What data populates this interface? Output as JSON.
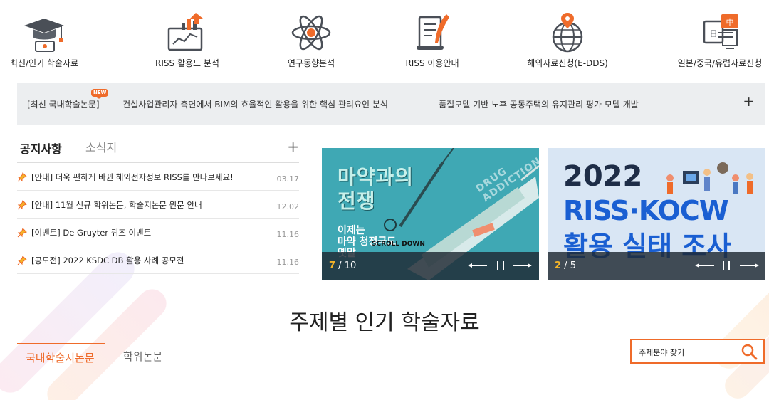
{
  "quick_menu": [
    {
      "label": "최신/인기 학술자료",
      "icon": "graduation-cap-icon"
    },
    {
      "label": "RISS 활용도 분석",
      "icon": "bar-chart-icon"
    },
    {
      "label": "연구동향분석",
      "icon": "atom-icon"
    },
    {
      "label": "RISS 이용안내",
      "icon": "scroll-quill-icon"
    },
    {
      "label": "해외자료신청(E-DDS)",
      "icon": "globe-pin-icon"
    },
    {
      "label": "일본/중국/유럽자료신청",
      "icon": "language-board-icon",
      "badge_cn": "中",
      "badge_jp": "日"
    }
  ],
  "recent_papers": {
    "category": "[최신 국내학술논문]",
    "new_badge": "NEW",
    "items": [
      "- 건설사업관리자 측면에서 BIM의 효율적인 활용을 위한 핵심 관리요인 분석",
      "- 품질모델 기반 노후 공동주택의 유지관리 평가 모델 개발"
    ],
    "more": "+"
  },
  "notice": {
    "tabs": [
      "공지사항",
      "소식지"
    ],
    "more": "+",
    "items": [
      {
        "title": "[안내] 더욱 편하게 바뀐 해외전자정보 RISS를 만나보세요!",
        "date": "03.17"
      },
      {
        "title": "[안내] 11월 신규 학위논문, 학술지논문 원문 안내",
        "date": "12.02"
      },
      {
        "title": "[이벤트] De Gruyter 퀴즈 이벤트",
        "date": "11.16"
      },
      {
        "title": "[공모전] 2022 KSDC DB 활용 사례 공모전",
        "date": "11.16"
      }
    ]
  },
  "banners": [
    {
      "current": "7",
      "total": "10",
      "headline": "마약과의\n전쟁",
      "sub": "이제는\n마약 청정국도\n옛말",
      "tag": "SCROLL DOWN",
      "deco": "DRUG ADDICTION"
    },
    {
      "current": "2",
      "total": "5",
      "year": "2022",
      "headline": "RISS·KOCW",
      "sub": "활용 실태 조사"
    }
  ],
  "section_title": "주제별 인기 학술자료",
  "subject_tabs": [
    "국내학술지논문",
    "학위논문"
  ],
  "subject_search": {
    "label": "주제분야 찾기"
  },
  "colors": {
    "accent": "#ef6b2a",
    "bar_bg": "#eceef0",
    "page_highlight": "#f5b428"
  }
}
